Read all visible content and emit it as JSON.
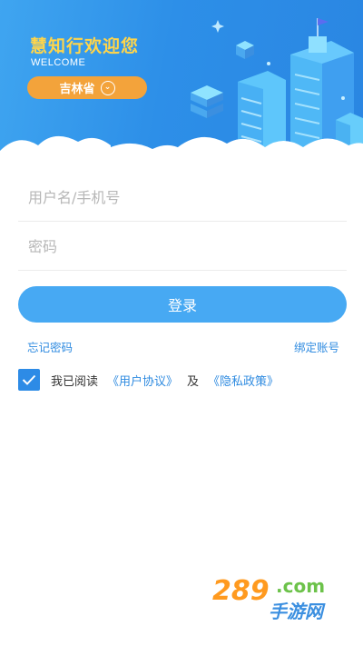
{
  "header": {
    "title": "慧知行欢迎您",
    "subtitle": "WELCOME",
    "province": "吉林省"
  },
  "form": {
    "username_placeholder": "用户名/手机号",
    "password_placeholder": "密码",
    "login_label": "登录"
  },
  "links": {
    "forgot_password": "忘记密码",
    "bind_account": "绑定账号"
  },
  "agreement": {
    "checked": true,
    "prefix": "我已阅读",
    "user_agreement": "《用户协议》",
    "and": "及",
    "privacy_policy": "《隐私政策》"
  },
  "watermark": {
    "number": "289",
    "domain": ".com",
    "text": "手游网"
  },
  "colors": {
    "primary": "#47a9f3",
    "banner": "#2d8fe8",
    "title_gold": "#ffd54a",
    "pill_orange": "#f3a33b",
    "link_blue": "#2f8be0"
  }
}
